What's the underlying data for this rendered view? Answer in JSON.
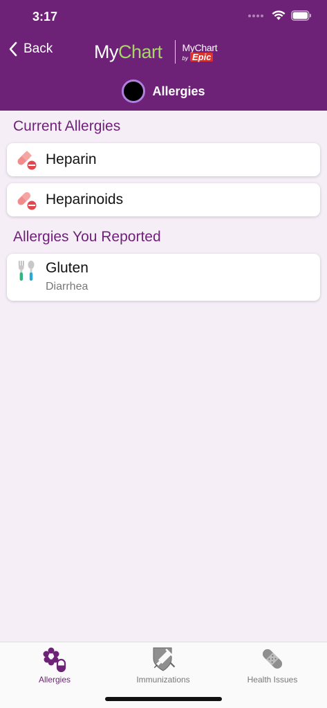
{
  "status_bar": {
    "time": "3:17"
  },
  "header": {
    "back_label": "Back",
    "logo": {
      "my": "My",
      "chart": "Chart",
      "epic_top": "MyChart",
      "epic_by": "by",
      "epic_word": "Epic"
    },
    "title": "Allergies"
  },
  "sections": [
    {
      "title": "Current Allergies",
      "items": [
        {
          "name": "Heparin",
          "icon": "pill-icon"
        },
        {
          "name": "Heparinoids",
          "icon": "pill-icon"
        }
      ]
    },
    {
      "title": "Allergies You Reported",
      "items": [
        {
          "name": "Gluten",
          "detail": "Diarrhea",
          "icon": "utensils-icon"
        }
      ]
    }
  ],
  "tabs": [
    {
      "label": "Allergies",
      "icon": "allergies-icon",
      "active": true
    },
    {
      "label": "Immunizations",
      "icon": "immunizations-icon",
      "active": false
    },
    {
      "label": "Health Issues",
      "icon": "bandage-icon",
      "active": false
    }
  ],
  "colors": {
    "brand_purple": "#6e2277",
    "logo_green": "#a9d46b",
    "background": "#f5eef7",
    "pill_pink": "#f28b8b",
    "pill_red": "#e4484f"
  }
}
